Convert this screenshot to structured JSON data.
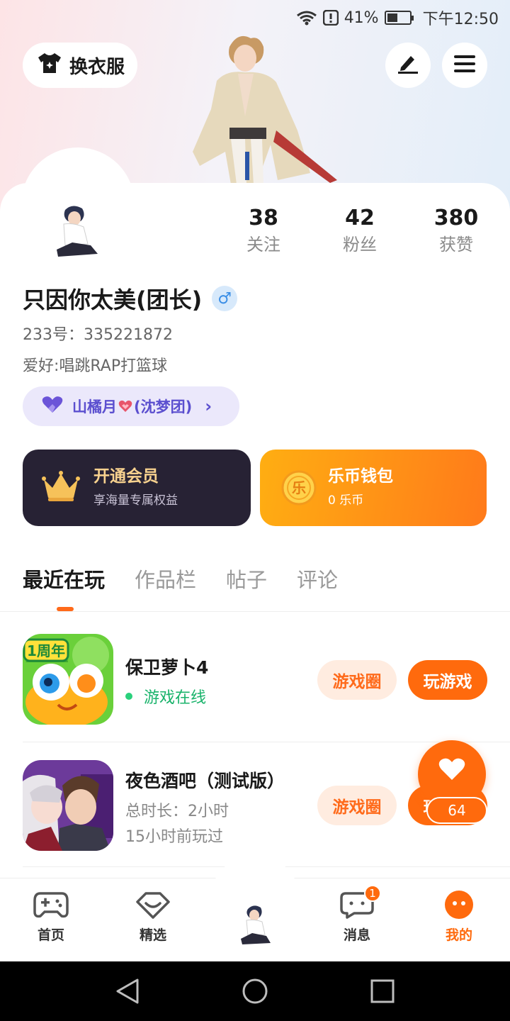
{
  "status_bar": {
    "battery": "41%",
    "time": "下午12:50"
  },
  "header": {
    "outfit_label": "换衣服",
    "icons": [
      "shirt-icon",
      "edit-icon",
      "menu-icon"
    ]
  },
  "profile": {
    "stats": [
      {
        "value": "38",
        "label": "关注"
      },
      {
        "value": "42",
        "label": "粉丝"
      },
      {
        "value": "380",
        "label": "获赞"
      }
    ],
    "username": "只因你太美(团长)",
    "gender_symbol": "♂",
    "uid": "233号：335221872",
    "hobby": "爱好:唱跳RAP打篮球",
    "group": {
      "name_part1": "山橘月",
      "name_part2": "(沈梦团)"
    }
  },
  "cards": {
    "vip": {
      "title": "开通会员",
      "subtitle": "享海量专属权益"
    },
    "wallet": {
      "title": "乐币钱包",
      "subtitle": "0 乐币",
      "coin_glyph": "乐"
    }
  },
  "tabs": [
    {
      "label": "最近在玩",
      "active": true
    },
    {
      "label": "作品栏",
      "active": false
    },
    {
      "label": "帖子",
      "active": false
    },
    {
      "label": "评论",
      "active": false
    }
  ],
  "games": [
    {
      "name": "保卫萝卜4",
      "status": "游戏在线",
      "icon_badge": "1周年",
      "circle_label": "游戏圈",
      "play_label": "玩游戏"
    },
    {
      "name": "夜色酒吧（测试版）",
      "total_time": "总时长：2小时",
      "last_played": "15小时前玩过",
      "circle_label": "游戏圈",
      "play_label": "玩游戏"
    }
  ],
  "like_fab": {
    "count": "64"
  },
  "bottom_nav": [
    {
      "label": "首页",
      "icon": "gamepad-icon"
    },
    {
      "label": "精选",
      "icon": "heart-tag-icon"
    },
    {
      "label": "",
      "icon": "avatar-center"
    },
    {
      "label": "消息",
      "icon": "chat-icon",
      "badge": "1"
    },
    {
      "label": "我的",
      "icon": "me-icon",
      "active": true
    }
  ],
  "colors": {
    "accent": "#ff6a0d",
    "online_green": "#19b36b",
    "vip_card": "#272234",
    "group_pill": "#ebe8fb"
  }
}
